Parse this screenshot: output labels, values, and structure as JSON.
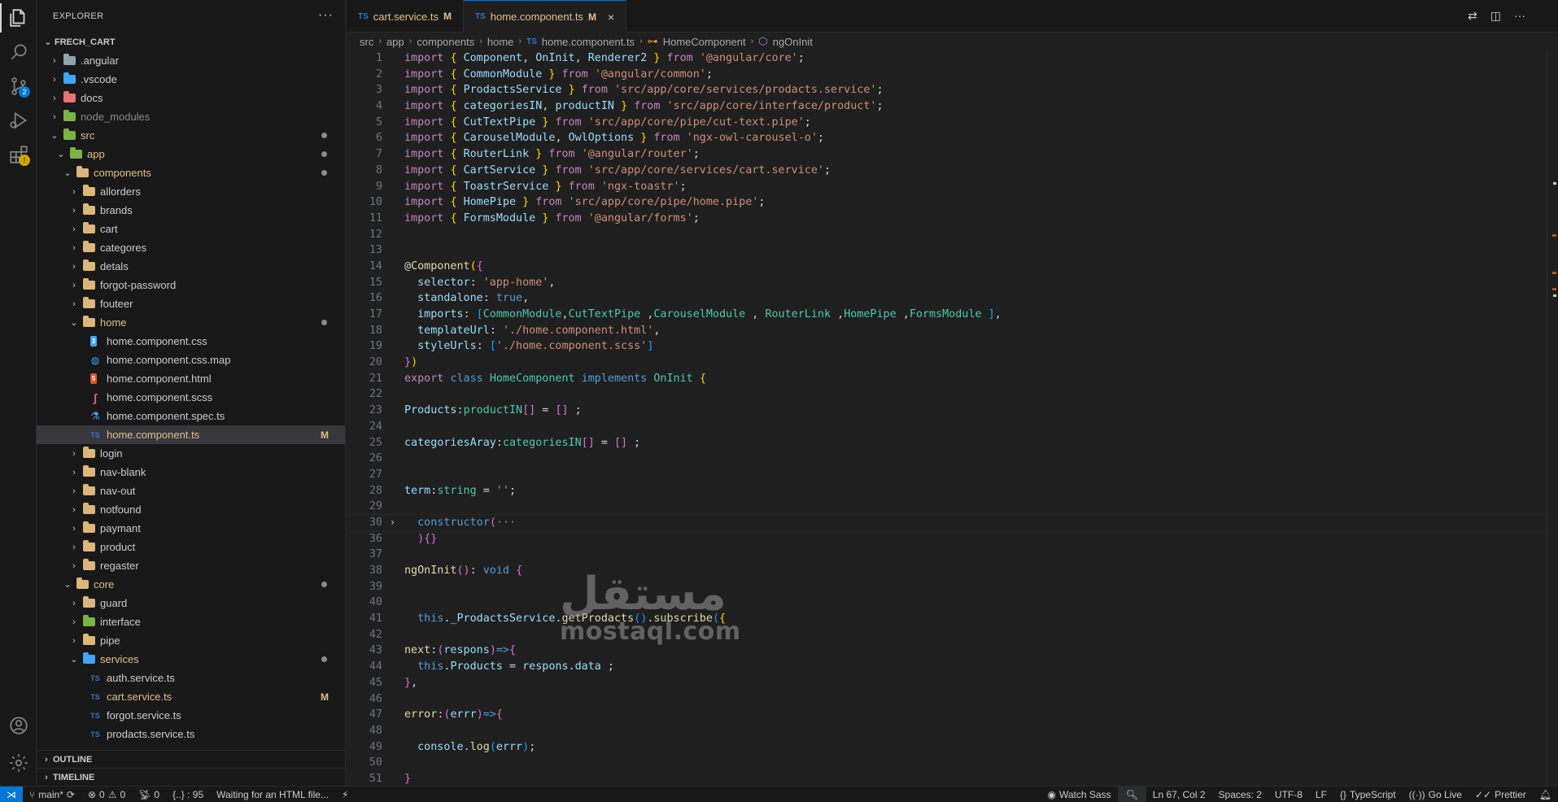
{
  "sidebar": {
    "title": "EXPLORER",
    "more": "···",
    "project": "FRECH_CART",
    "tree": [
      {
        "label": ".angular",
        "depth": 1,
        "type": "folder",
        "color": "gray",
        "chevron": "›"
      },
      {
        "label": ".vscode",
        "depth": 1,
        "type": "folder",
        "color": "blue",
        "chevron": "›"
      },
      {
        "label": "docs",
        "depth": 1,
        "type": "folder",
        "color": "red",
        "chevron": "›"
      },
      {
        "label": "node_modules",
        "depth": 1,
        "type": "folder",
        "color": "green",
        "chevron": "›",
        "dim": true
      },
      {
        "label": "src",
        "depth": 1,
        "type": "folder",
        "color": "green",
        "chevron": "⌄",
        "mod": true,
        "dot": true
      },
      {
        "label": "app",
        "depth": 2,
        "type": "folder",
        "color": "green",
        "chevron": "⌄",
        "mod": true,
        "dot": true
      },
      {
        "label": "components",
        "depth": 3,
        "type": "folder",
        "color": "",
        "chevron": "⌄",
        "mod": true,
        "dot": true
      },
      {
        "label": "allorders",
        "depth": 4,
        "type": "folder",
        "color": "",
        "chevron": "›"
      },
      {
        "label": "brands",
        "depth": 4,
        "type": "folder",
        "color": "",
        "chevron": "›"
      },
      {
        "label": "cart",
        "depth": 4,
        "type": "folder",
        "color": "",
        "chevron": "›"
      },
      {
        "label": "categores",
        "depth": 4,
        "type": "folder",
        "color": "",
        "chevron": "›"
      },
      {
        "label": "detals",
        "depth": 4,
        "type": "folder",
        "color": "",
        "chevron": "›"
      },
      {
        "label": "forgot-password",
        "depth": 4,
        "type": "folder",
        "color": "",
        "chevron": "›"
      },
      {
        "label": "fouteer",
        "depth": 4,
        "type": "folder",
        "color": "",
        "chevron": "›"
      },
      {
        "label": "home",
        "depth": 4,
        "type": "folder",
        "color": "",
        "chevron": "⌄",
        "mod": true,
        "dot": true
      },
      {
        "label": "home.component.css",
        "depth": 5,
        "type": "css"
      },
      {
        "label": "home.component.css.map",
        "depth": 5,
        "type": "map"
      },
      {
        "label": "home.component.html",
        "depth": 5,
        "type": "html"
      },
      {
        "label": "home.component.scss",
        "depth": 5,
        "type": "scss"
      },
      {
        "label": "home.component.spec.ts",
        "depth": 5,
        "type": "spec"
      },
      {
        "label": "home.component.ts",
        "depth": 5,
        "type": "ts",
        "selected": true,
        "badge": "M"
      },
      {
        "label": "login",
        "depth": 4,
        "type": "folder",
        "color": "",
        "chevron": "›"
      },
      {
        "label": "nav-blank",
        "depth": 4,
        "type": "folder",
        "color": "",
        "chevron": "›"
      },
      {
        "label": "nav-out",
        "depth": 4,
        "type": "folder",
        "color": "",
        "chevron": "›"
      },
      {
        "label": "notfound",
        "depth": 4,
        "type": "folder",
        "color": "",
        "chevron": "›"
      },
      {
        "label": "paymant",
        "depth": 4,
        "type": "folder",
        "color": "",
        "chevron": "›"
      },
      {
        "label": "product",
        "depth": 4,
        "type": "folder",
        "color": "",
        "chevron": "›"
      },
      {
        "label": "regaster",
        "depth": 4,
        "type": "folder",
        "color": "",
        "chevron": "›"
      },
      {
        "label": "core",
        "depth": 3,
        "type": "folder",
        "color": "",
        "chevron": "⌄",
        "mod": true,
        "dot": true
      },
      {
        "label": "guard",
        "depth": 4,
        "type": "folder",
        "color": "",
        "chevron": "›"
      },
      {
        "label": "interface",
        "depth": 4,
        "type": "folder",
        "color": "green",
        "chevron": "›"
      },
      {
        "label": "pipe",
        "depth": 4,
        "type": "folder",
        "color": "",
        "chevron": "›"
      },
      {
        "label": "services",
        "depth": 4,
        "type": "folder",
        "color": "blue",
        "chevron": "⌄",
        "mod": true,
        "dot": true
      },
      {
        "label": "auth.service.ts",
        "depth": 5,
        "type": "ts"
      },
      {
        "label": "cart.service.ts",
        "depth": 5,
        "type": "ts",
        "mod": true,
        "badge": "M"
      },
      {
        "label": "forgot.service.ts",
        "depth": 5,
        "type": "ts"
      },
      {
        "label": "prodacts.service.ts",
        "depth": 5,
        "type": "ts"
      }
    ],
    "outline": "OUTLINE",
    "timeline": "TIMELINE"
  },
  "tabs": [
    {
      "icon": "TS",
      "label": "cart.service.ts",
      "badge": "M",
      "active": false
    },
    {
      "icon": "TS",
      "label": "home.component.ts",
      "badge": "M",
      "active": true,
      "close": "×"
    }
  ],
  "breadcrumb": [
    "src",
    "app",
    "components",
    "home",
    "home.component.ts",
    "HomeComponent",
    "ngOnInit"
  ],
  "code": [
    {
      "n": "1",
      "h": "<span class='k'>import</span> <span class='p'>{</span> <span class='v'>Component</span>, <span class='v'>OnInit</span>, <span class='v'>Renderer2</span> <span class='p'>}</span> <span class='k'>from</span> <span class='s'>'@angular/core'</span>;"
    },
    {
      "n": "2",
      "h": "<span class='k'>import</span> <span class='p'>{</span> <span class='v'>CommonModule</span> <span class='p'>}</span> <span class='k'>from</span> <span class='s'>'@angular/common'</span>;"
    },
    {
      "n": "3",
      "h": "<span class='k'>import</span> <span class='p'>{</span> <span class='v'>ProdactsService</span> <span class='p'>}</span> <span class='k'>from</span> <span class='s'>'src/app/core/services/prodacts.service'</span>;"
    },
    {
      "n": "4",
      "h": "<span class='k'>import</span> <span class='p'>{</span> <span class='v'>categoriesIN</span>, <span class='v'>productIN</span> <span class='p'>}</span> <span class='k'>from</span> <span class='s'>'src/app/core/interface/product'</span>;"
    },
    {
      "n": "5",
      "h": "<span class='k'>import</span> <span class='p'>{</span> <span class='v'>CutTextPipe</span> <span class='p'>}</span> <span class='k'>from</span> <span class='s'>'src/app/core/pipe/cut-text.pipe'</span>;"
    },
    {
      "n": "6",
      "h": "<span class='k'>import</span> <span class='p'>{</span> <span class='v'>CarouselModule</span>, <span class='v'>OwlOptions</span> <span class='p'>}</span> <span class='k'>from</span> <span class='s'>'ngx-owl-carousel-o'</span>;"
    },
    {
      "n": "7",
      "h": "<span class='k'>import</span> <span class='p'>{</span> <span class='v'>RouterLink</span> <span class='p'>}</span> <span class='k'>from</span> <span class='s'>'@angular/router'</span>;"
    },
    {
      "n": "8",
      "h": "<span class='k'>import</span> <span class='p'>{</span> <span class='v'>CartService</span> <span class='p'>}</span> <span class='k'>from</span> <span class='s'>'src/app/core/services/cart.service'</span>;"
    },
    {
      "n": "9",
      "h": "<span class='k'>import</span> <span class='p'>{</span> <span class='v'>ToastrService</span> <span class='p'>}</span> <span class='k'>from</span> <span class='s'>'ngx-toastr'</span>;"
    },
    {
      "n": "10",
      "h": "<span class='k'>import</span> <span class='p'>{</span> <span class='v'>HomePipe</span> <span class='p'>}</span> <span class='k'>from</span> <span class='s'>'src/app/core/pipe/home.pipe'</span>;"
    },
    {
      "n": "11",
      "h": "<span class='k'>import</span> <span class='p'>{</span> <span class='v'>FormsModule</span> <span class='p'>}</span> <span class='k'>from</span> <span class='s'>'@angular/forms'</span>;"
    },
    {
      "n": "12",
      "h": ""
    },
    {
      "n": "13",
      "h": ""
    },
    {
      "n": "14",
      "h": "@<span class='f'>Component</span><span class='p'>(</span><span class='p2'>{</span>"
    },
    {
      "n": "15",
      "h": "  <span class='v'>selector</span>: <span class='s'>'app-home'</span>,"
    },
    {
      "n": "16",
      "h": "  <span class='v'>standalone</span>: <span class='kw'>true</span>,"
    },
    {
      "n": "17",
      "h": "  <span class='v'>imports</span>: <span class='p3'>[</span><span class='t'>CommonModule</span>,<span class='t'>CutTextPipe</span> ,<span class='t'>CarouselModule</span> , <span class='t'>RouterLink</span> ,<span class='t'>HomePipe</span> ,<span class='t'>FormsModule</span> <span class='p3'>]</span>,"
    },
    {
      "n": "18",
      "h": "  <span class='v'>templateUrl</span>: <span class='s'>'./home.component.html'</span>,"
    },
    {
      "n": "19",
      "h": "  <span class='v'>styleUrls</span>: <span class='p3'>[</span><span class='s'>'./home.component.scss'</span><span class='p3'>]</span>"
    },
    {
      "n": "20",
      "h": "<span class='p2'>}</span><span class='p'>)</span>"
    },
    {
      "n": "21",
      "h": "<span class='k'>export</span> <span class='kw'>class</span> <span class='t'>HomeComponent</span> <span class='kw'>implements</span> <span class='t'>OnInit</span> <span class='p'>{</span>"
    },
    {
      "n": "22",
      "h": ""
    },
    {
      "n": "23",
      "h": "<span class='v'>Products</span>:<span class='t'>productIN</span><span class='p2'>[]</span> = <span class='p2'>[]</span> ;"
    },
    {
      "n": "24",
      "h": ""
    },
    {
      "n": "25",
      "h": "<span class='v'>categoriesAray</span>:<span class='t'>categoriesIN</span><span class='p2'>[]</span> = <span class='p2'>[]</span> ;"
    },
    {
      "n": "26",
      "h": ""
    },
    {
      "n": "27",
      "h": ""
    },
    {
      "n": "28",
      "h": "<span class='v'>term</span>:<span class='t'>string</span> = <span class='s'>''</span>;"
    },
    {
      "n": "29",
      "h": ""
    },
    {
      "n": "30",
      "h": "  <span class='kw'>constructor</span><span class='p2'>(</span><span class='ellip'>···</span>",
      "fold": "›"
    },
    {
      "n": "36",
      "h": "  <span class='p2'>)</span><span class='p2'>{}</span>"
    },
    {
      "n": "37",
      "h": ""
    },
    {
      "n": "38",
      "h": "<span class='f'>ngOnInit</span><span class='p2'>()</span>: <span class='kw'>void</span> <span class='p2'>{</span>"
    },
    {
      "n": "39",
      "h": ""
    },
    {
      "n": "40",
      "h": ""
    },
    {
      "n": "41",
      "h": "  <span class='kw'>this</span>.<span class='v'>_ProdactsService</span>.<span class='f'>getProdacts</span><span class='p3'>()</span>.<span class='f'>subscribe</span><span class='p3'>(</span><span class='p'>{</span>"
    },
    {
      "n": "42",
      "h": ""
    },
    {
      "n": "43",
      "h": "<span class='f'>next</span>:<span class='p2'>(</span><span class='v'>respons</span><span class='p2'>)</span><span class='kw'>=&gt;</span><span class='p2'>{</span>"
    },
    {
      "n": "44",
      "h": "  <span class='kw'>this</span>.<span class='v'>Products</span> = <span class='v'>respons</span>.<span class='v'>data</span> ;"
    },
    {
      "n": "45",
      "h": "<span class='p2'>}</span>,"
    },
    {
      "n": "46",
      "h": ""
    },
    {
      "n": "47",
      "h": "<span class='f'>error</span>:<span class='p2'>(</span><span class='v'>errr</span><span class='p2'>)</span><span class='kw'>=&gt;</span><span class='p2'>{</span>"
    },
    {
      "n": "48",
      "h": ""
    },
    {
      "n": "49",
      "h": "  <span class='v'>console</span>.<span class='f'>log</span><span class='p3'>(</span><span class='v'>errr</span><span class='p3'>)</span>;"
    },
    {
      "n": "50",
      "h": ""
    },
    {
      "n": "51",
      "h": "<span class='p2'>}</span>"
    }
  ],
  "watermark": {
    "arabic": "مستقل",
    "latin": "mostaql.com"
  },
  "statusbar": {
    "branch": "main*",
    "errors": "0",
    "warnings": "0",
    "ports": "0",
    "json": "{..} : 95",
    "message": "Waiting for an HTML file...",
    "watch_sass": "Watch Sass",
    "position": "Ln 67, Col 2",
    "spaces": "Spaces: 2",
    "encoding": "UTF-8",
    "eol": "LF",
    "language": "TypeScript",
    "golive": "Go Live",
    "prettier": "Prettier"
  },
  "activity_badges": {
    "source_control": "2",
    "extensions": "!"
  }
}
